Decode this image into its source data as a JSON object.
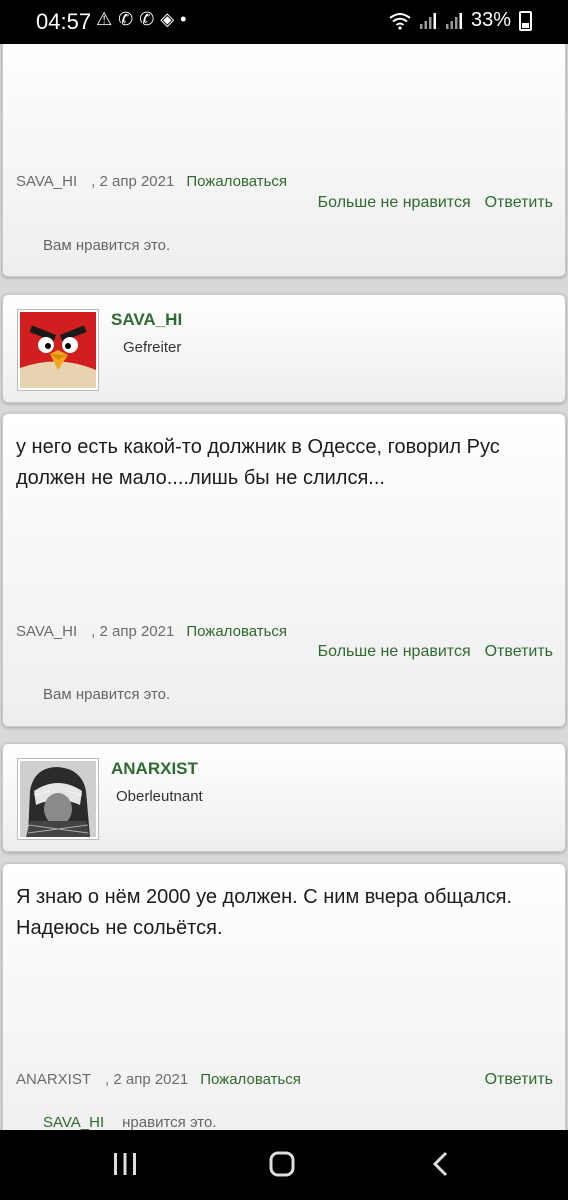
{
  "status_bar": {
    "time": "04:57",
    "battery": "33%"
  },
  "posts": [
    {
      "text_lines": [],
      "author": "SAVA_HI",
      "date": ", 2 апр 2021",
      "report": "Пожаловаться",
      "unlike": "Больше не нравится",
      "reply": "Ответить",
      "likes_text": "Вам нравится это."
    },
    {
      "user": {
        "name": "SAVA_HI",
        "rank": "Gefreiter",
        "avatar_icon": "angry-bird-avatar"
      },
      "text": "у него есть какой-то должник в Одессе, говорил Рус должен не мало....лишь бы не слился...",
      "author": "SAVA_HI",
      "date": ", 2 апр 2021",
      "report": "Пожаловаться",
      "unlike": "Больше не нравится",
      "reply": "Ответить",
      "likes_text": "Вам нравится это."
    },
    {
      "user": {
        "name": "ANARXIST",
        "rank": "Oberleutnant",
        "avatar_icon": "keffiyeh-portrait-avatar"
      },
      "text": "Я знаю о нём 2000 уе должен. С ним вчера общался. Надеюсь не сольётся.",
      "author": "ANARXIST",
      "date": ", 2 апр 2021",
      "report": "Пожаловаться",
      "reply": "Ответить",
      "likes_who": "SAVA_HI",
      "likes_text": "нравится это."
    }
  ],
  "colors": {
    "link": "#2f6a2f",
    "background": "#d8d8d8"
  }
}
